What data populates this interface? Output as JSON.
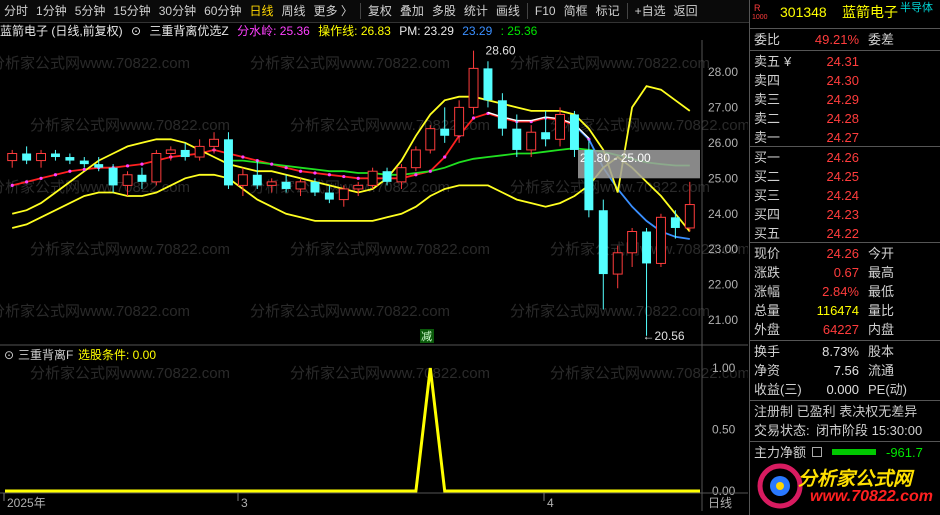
{
  "toolbar": {
    "items": [
      "分时",
      "1分钟",
      "5分钟",
      "15分钟",
      "30分钟",
      "60分钟",
      "日线",
      "周线",
      "更多 〉",
      "复权",
      "叠加",
      "多股",
      "统计",
      "画线",
      "F10",
      "简框",
      "标记",
      "+自选",
      "返回"
    ],
    "active_index": 6
  },
  "main_title": {
    "stock": "蓝箭电子 (日线,前复权)",
    "indicator": "三重背离优选Z",
    "fsl_label": "分水岭: 25.36",
    "czx_label": "操作线: 26.83",
    "pm_label": "PM: 23.29",
    "v2_label": "23.29",
    "v3_label": ": 25.36"
  },
  "sub_title": {
    "indicator": "三重背离F",
    "cond_label": "选股条件: 0.00"
  },
  "price_axis": [
    "28.00",
    "27.00",
    "26.00",
    "25.00",
    "24.00",
    "23.00",
    "22.00",
    "21.00"
  ],
  "sub_axis": [
    "1.00",
    "0.50",
    "0.00"
  ],
  "date_axis": [
    "2025年",
    "3",
    "4"
  ],
  "date_axis_right": "日线",
  "annotations": {
    "high": "28.60",
    "low": "←20.56",
    "box_label": "25.80 - 25.00",
    "signal": "减"
  },
  "watermark": "分析家公式网www.70822.com",
  "logo": {
    "text": "分析家公式网",
    "url": "www.70822.com"
  },
  "quote": {
    "code": "301348",
    "name": "蓝箭电子",
    "tag": "半导体",
    "r_badge": "R",
    "r_sub": "1000",
    "weibi_label": "委比",
    "weibi": "49.21%",
    "weicha_label": "委差",
    "sell": [
      {
        "label": "卖五",
        "flag": "¥",
        "price": "24.31"
      },
      {
        "label": "卖四",
        "flag": "",
        "price": "24.30"
      },
      {
        "label": "卖三",
        "flag": "",
        "price": "24.29"
      },
      {
        "label": "卖二",
        "flag": "",
        "price": "24.28"
      },
      {
        "label": "卖一",
        "flag": "",
        "price": "24.27"
      }
    ],
    "buy": [
      {
        "label": "买一",
        "price": "24.26"
      },
      {
        "label": "买二",
        "price": "24.25"
      },
      {
        "label": "买三",
        "price": "24.24"
      },
      {
        "label": "买四",
        "price": "24.23"
      },
      {
        "label": "买五",
        "price": "24.22"
      }
    ],
    "stats": [
      {
        "label": "现价",
        "value": "24.26",
        "label2": "今开"
      },
      {
        "label": "涨跌",
        "value": "0.67",
        "label2": "最高"
      },
      {
        "label": "涨幅",
        "value": "2.84%",
        "label2": "最低"
      },
      {
        "label": "总量",
        "value": "116474",
        "label2": "量比"
      },
      {
        "label": "外盘",
        "value": "64227",
        "label2": "内盘"
      }
    ],
    "stats2": [
      {
        "label": "换手",
        "value": "8.73%",
        "label2": "股本"
      },
      {
        "label": "净资",
        "value": "7.56",
        "label2": "流通"
      },
      {
        "label": "收益(三)",
        "value": "0.000",
        "label2": "PE(动)"
      }
    ],
    "tags_line": "注册制 已盈利 表决权无差异",
    "trade_state_label": "交易状态:",
    "trade_state": "闭市阶段 15:30:00",
    "main_flow_label": "主力净额",
    "main_flow": "-961.7"
  },
  "chart_data": {
    "type": "candlestick",
    "price_range": [
      20.3,
      28.9
    ],
    "candles": [
      [
        25.5,
        25.8,
        25.3,
        25.7
      ],
      [
        25.7,
        25.9,
        25.4,
        25.5
      ],
      [
        25.5,
        25.8,
        25.3,
        25.7
      ],
      [
        25.7,
        25.8,
        25.5,
        25.6
      ],
      [
        25.6,
        25.7,
        25.4,
        25.5
      ],
      [
        25.5,
        25.6,
        25.3,
        25.4
      ],
      [
        25.4,
        25.6,
        25.2,
        25.3
      ],
      [
        25.3,
        25.4,
        24.6,
        24.8
      ],
      [
        24.8,
        25.2,
        24.5,
        25.1
      ],
      [
        25.1,
        25.3,
        24.7,
        24.9
      ],
      [
        24.9,
        25.8,
        24.8,
        25.7
      ],
      [
        25.7,
        25.9,
        25.5,
        25.8
      ],
      [
        25.8,
        26.0,
        25.5,
        25.6
      ],
      [
        25.6,
        26.1,
        25.5,
        25.9
      ],
      [
        25.9,
        26.3,
        25.7,
        26.1
      ],
      [
        26.1,
        26.3,
        24.7,
        24.8
      ],
      [
        24.8,
        25.3,
        24.5,
        25.1
      ],
      [
        25.1,
        25.5,
        24.7,
        24.8
      ],
      [
        24.8,
        25.0,
        24.6,
        24.9
      ],
      [
        24.9,
        25.1,
        24.6,
        24.7
      ],
      [
        24.7,
        25.0,
        24.5,
        24.9
      ],
      [
        24.9,
        25.0,
        24.5,
        24.6
      ],
      [
        24.6,
        24.8,
        24.3,
        24.4
      ],
      [
        24.4,
        24.8,
        24.2,
        24.7
      ],
      [
        24.7,
        24.9,
        24.5,
        24.8
      ],
      [
        24.8,
        25.3,
        24.7,
        25.2
      ],
      [
        25.2,
        25.3,
        24.8,
        24.9
      ],
      [
        24.9,
        25.4,
        24.7,
        25.3
      ],
      [
        25.3,
        25.9,
        25.2,
        25.8
      ],
      [
        25.8,
        26.5,
        25.7,
        26.4
      ],
      [
        26.4,
        27.0,
        26.0,
        26.2
      ],
      [
        26.2,
        27.2,
        26.0,
        27.0
      ],
      [
        27.0,
        28.6,
        26.8,
        28.1
      ],
      [
        28.1,
        28.3,
        27.0,
        27.2
      ],
      [
        27.2,
        27.4,
        26.2,
        26.4
      ],
      [
        26.4,
        26.8,
        25.6,
        25.8
      ],
      [
        25.8,
        26.5,
        25.6,
        26.3
      ],
      [
        26.3,
        26.9,
        25.9,
        26.1
      ],
      [
        26.1,
        27.0,
        25.9,
        26.8
      ],
      [
        26.8,
        26.9,
        25.6,
        25.8
      ],
      [
        25.8,
        26.1,
        23.9,
        24.1
      ],
      [
        24.1,
        24.4,
        21.3,
        22.3
      ],
      [
        22.3,
        23.1,
        21.9,
        22.9
      ],
      [
        22.9,
        23.6,
        22.5,
        23.5
      ],
      [
        23.5,
        23.6,
        20.56,
        22.6
      ],
      [
        22.6,
        24.0,
        22.5,
        23.9
      ],
      [
        23.9,
        24.1,
        23.3,
        23.6
      ],
      [
        23.6,
        24.9,
        23.5,
        24.26
      ]
    ],
    "series": [
      {
        "name": "操作线",
        "color": "#ff2020",
        "values": [
          24.8,
          24.9,
          25.0,
          25.1,
          25.2,
          25.25,
          25.3,
          25.3,
          25.35,
          25.4,
          25.5,
          25.6,
          25.65,
          25.7,
          25.8,
          25.7,
          25.6,
          25.5,
          25.4,
          25.3,
          25.2,
          25.15,
          25.1,
          25.05,
          25.0,
          25.0,
          25.0,
          25.0,
          25.1,
          25.2,
          25.6,
          26.2,
          26.7,
          26.83,
          26.7,
          26.6,
          26.6,
          26.7,
          26.65,
          26.5,
          26.1,
          null,
          null,
          null,
          null,
          null,
          null,
          null
        ]
      },
      {
        "name": "分水岭",
        "color": "#20e020",
        "values": [
          null,
          null,
          null,
          null,
          null,
          null,
          null,
          null,
          null,
          null,
          null,
          null,
          null,
          null,
          null,
          25.5,
          25.5,
          25.45,
          25.4,
          25.35,
          25.3,
          25.25,
          25.2,
          25.2,
          25.15,
          25.15,
          25.1,
          25.1,
          25.15,
          25.2,
          25.3,
          25.45,
          25.55,
          25.6,
          25.65,
          25.7,
          25.7,
          25.75,
          25.8,
          25.85,
          25.8,
          25.75,
          25.65,
          25.55,
          25.45,
          25.4,
          25.36,
          25.36
        ]
      },
      {
        "name": "PM",
        "color": "#3a8fff",
        "values": [
          null,
          null,
          null,
          null,
          null,
          null,
          null,
          null,
          null,
          null,
          null,
          null,
          null,
          null,
          null,
          null,
          null,
          null,
          null,
          null,
          null,
          null,
          null,
          null,
          null,
          null,
          null,
          null,
          null,
          null,
          null,
          null,
          null,
          null,
          null,
          null,
          null,
          null,
          null,
          26.5,
          26.1,
          25.3,
          24.7,
          24.2,
          23.8,
          23.5,
          23.35,
          23.29
        ]
      },
      {
        "name": "上轨",
        "color": "#ffff20",
        "values": [
          24.0,
          24.1,
          24.3,
          24.6,
          24.9,
          25.2,
          25.5,
          25.7,
          25.9,
          26.0,
          26.1,
          26.1,
          26.0,
          25.8,
          25.6,
          25.4,
          25.3,
          25.2,
          25.2,
          25.1,
          25.0,
          24.9,
          24.8,
          24.7,
          24.6,
          24.7,
          25.0,
          25.5,
          26.2,
          26.8,
          27.2,
          27.3,
          27.3,
          27.2,
          27.1,
          27.0,
          26.9,
          26.9,
          26.9,
          26.8,
          26.4,
          25.8,
          24.6,
          27.0,
          27.6,
          27.5,
          27.2,
          26.9
        ]
      },
      {
        "name": "下轨",
        "color": "#ffff20",
        "values": [
          23.6,
          23.7,
          23.9,
          24.1,
          24.3,
          24.5,
          24.6,
          24.6,
          24.5,
          24.5,
          24.6,
          24.8,
          25.0,
          25.1,
          25.1,
          25.0,
          24.7,
          24.4,
          24.2,
          24.0,
          23.9,
          23.8,
          23.8,
          23.8,
          23.8,
          23.8,
          23.9,
          24.0,
          24.2,
          24.5,
          24.7,
          24.8,
          24.8,
          24.8,
          24.6,
          24.4,
          24.3,
          24.2,
          24.3,
          24.5,
          24.8,
          25.3,
          25.6,
          25.3,
          24.9,
          24.5,
          24.0,
          23.5
        ]
      },
      {
        "name": "选股条件",
        "color": "#ffff00",
        "values": [
          0,
          0,
          0,
          0,
          0,
          0,
          0,
          0,
          0,
          0,
          0,
          0,
          0,
          0,
          0,
          0,
          0,
          0,
          0,
          0,
          0,
          0,
          0,
          0,
          0,
          0,
          0,
          0,
          0,
          1,
          0,
          0,
          0,
          0,
          0,
          0,
          0,
          0,
          0,
          0,
          0,
          0,
          0,
          0,
          0,
          0,
          0,
          0
        ]
      }
    ]
  }
}
